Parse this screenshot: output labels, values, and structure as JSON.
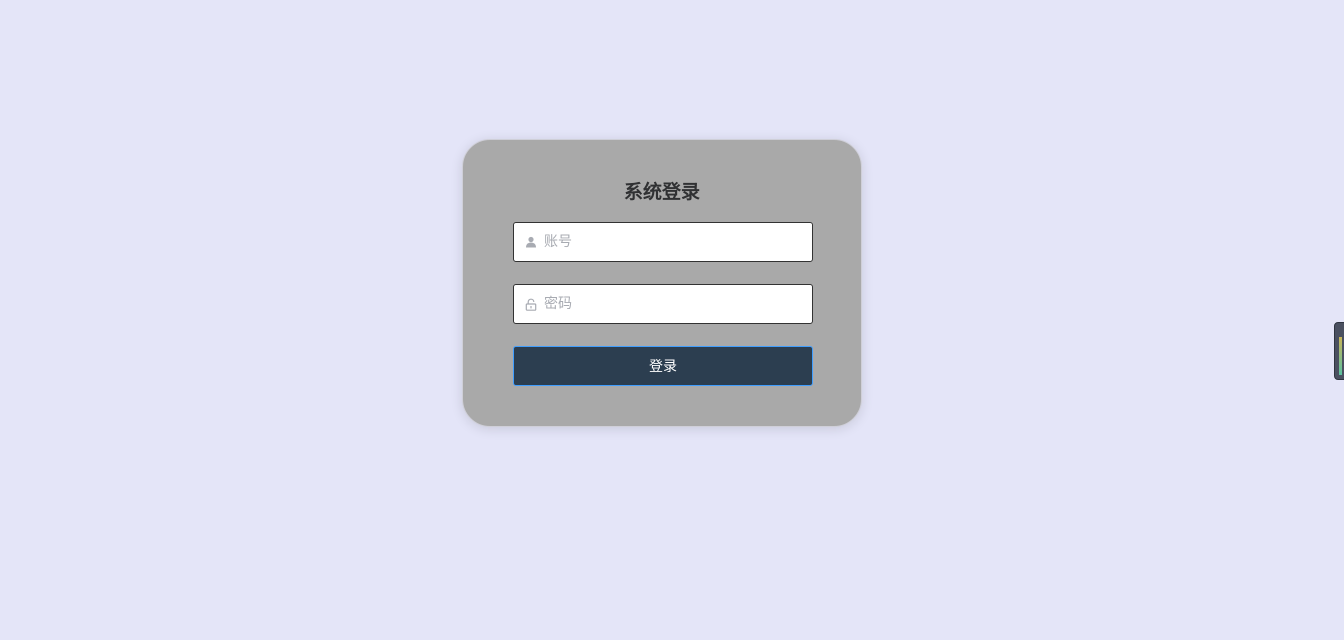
{
  "login": {
    "title": "系统登录",
    "username": {
      "placeholder": "账号",
      "value": "",
      "icon": "user-icon"
    },
    "password": {
      "placeholder": "密码",
      "value": "",
      "icon": "lock-icon"
    },
    "submit_label": "登录"
  },
  "colors": {
    "background": "#e4e5f8",
    "card": "#a9a9a9",
    "button": "#2c3e50",
    "button_border": "#409eff"
  }
}
